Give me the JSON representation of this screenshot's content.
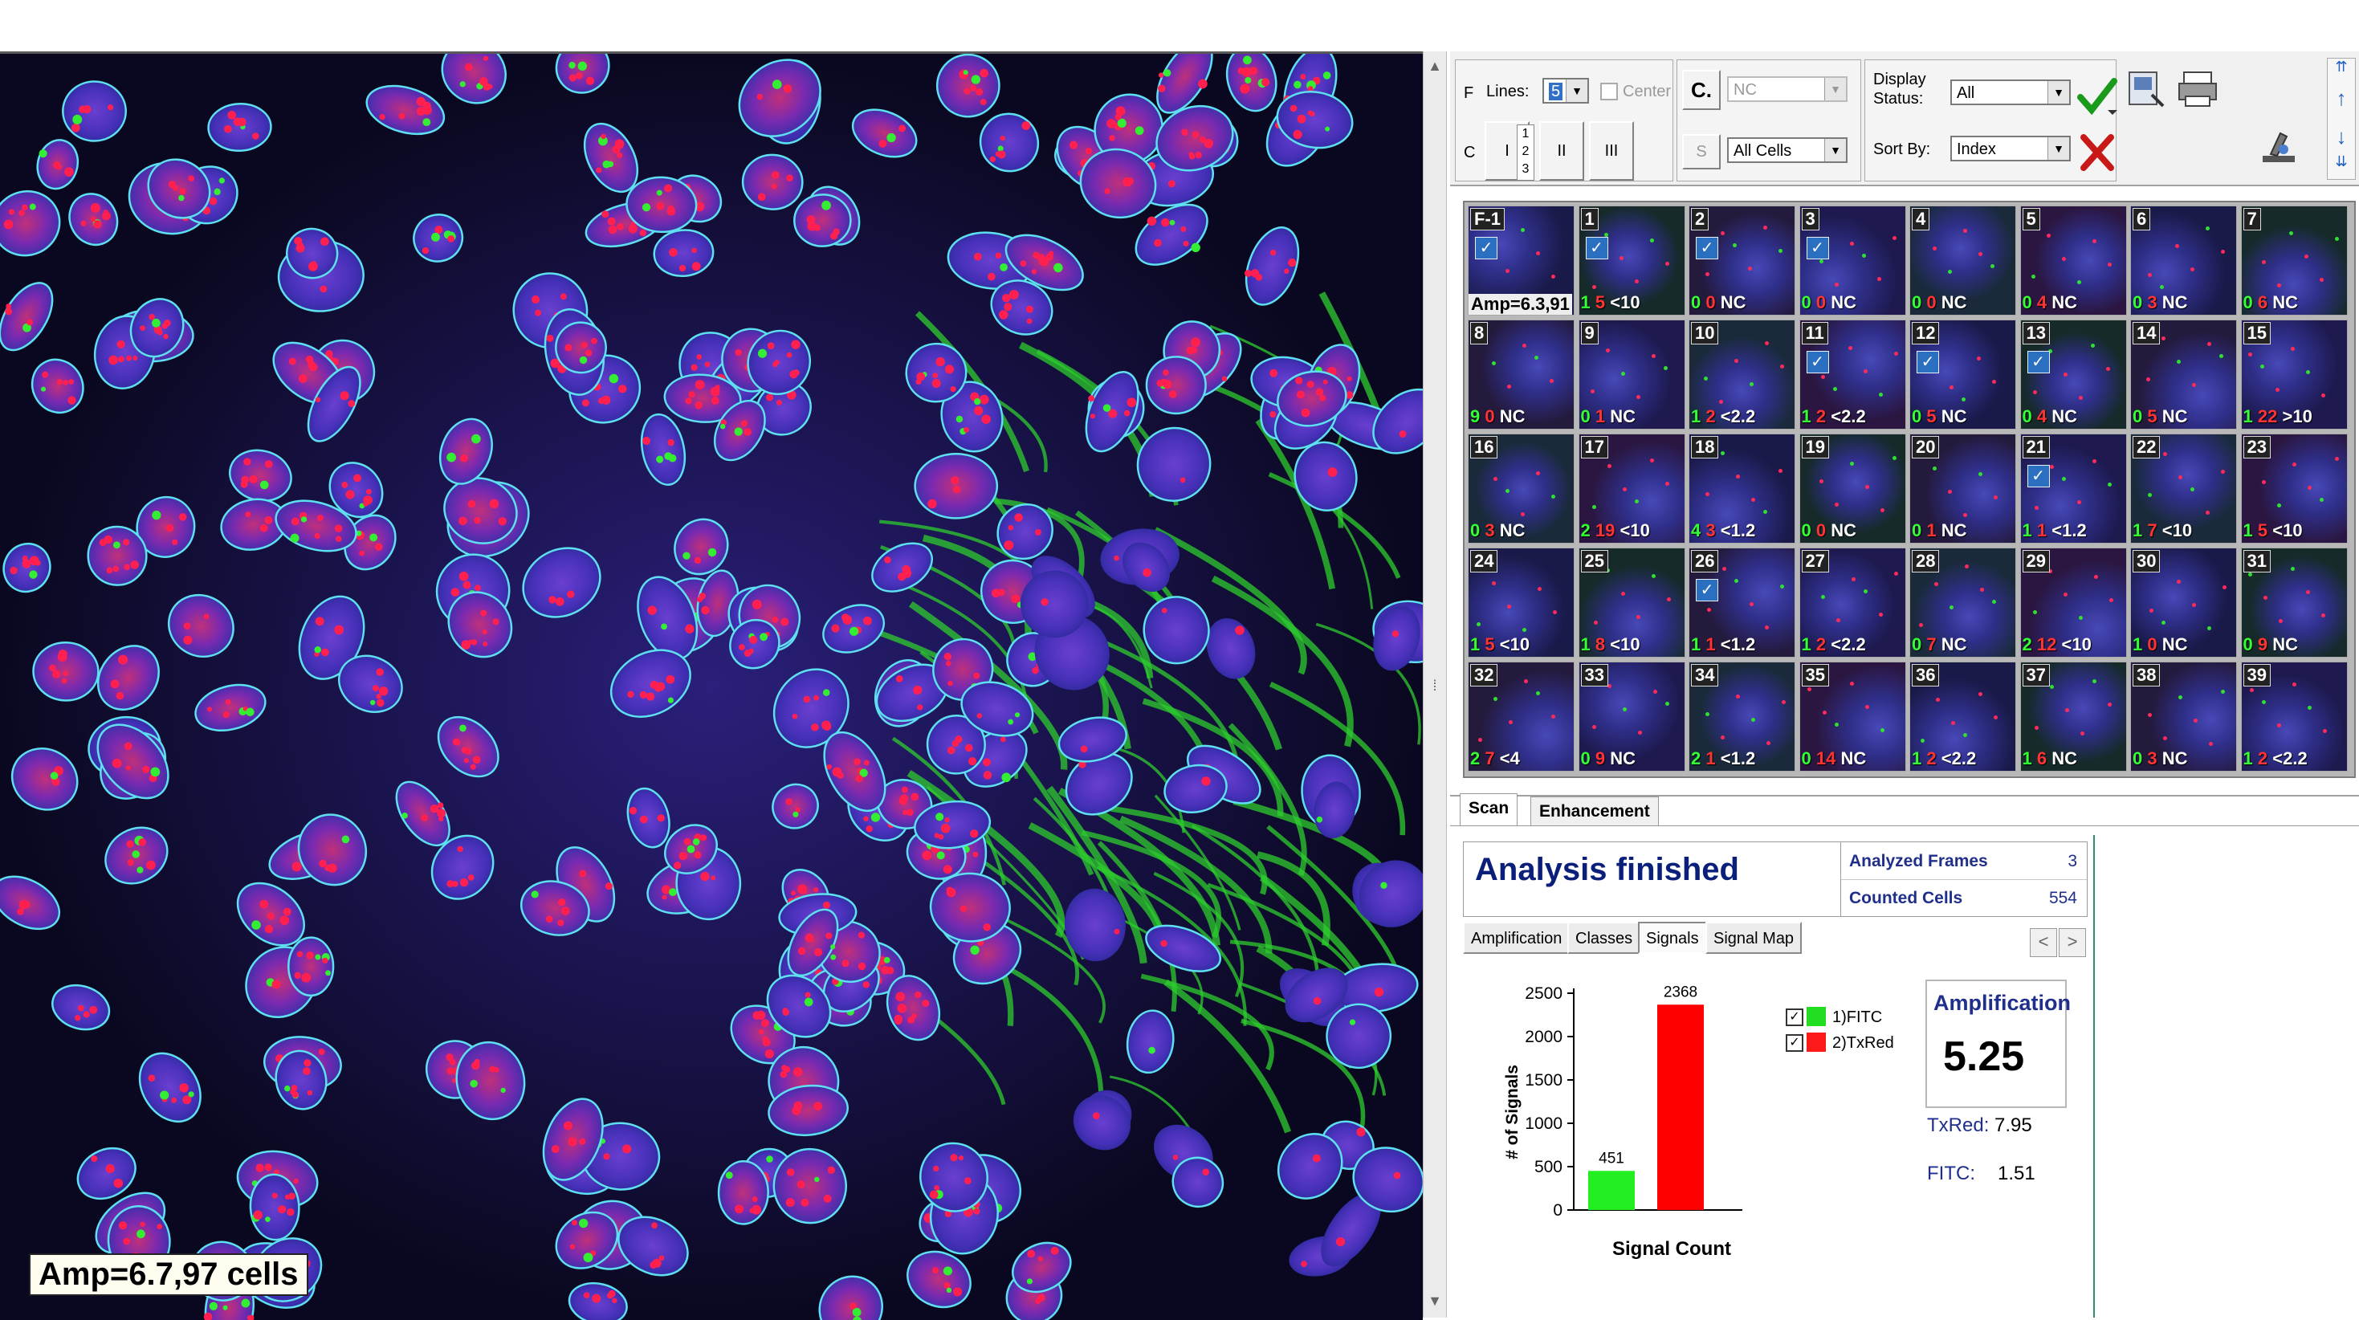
{
  "viewer": {
    "amp_label": "Amp=6.7,97 cells"
  },
  "toolbar": {
    "f_label": "F",
    "c_label": "C",
    "lines_label": "Lines:",
    "lines_value": "5",
    "center_label": "Center",
    "c_icon_label": "C.",
    "class_value": "NC",
    "s_label": "S",
    "cells_value": "All Cells",
    "display_status_label": "Display Status:",
    "display_status_value": "All",
    "sort_by_label": "Sort By:",
    "sort_by_value": "Index",
    "layout_buttons": [
      "I",
      "II",
      "III"
    ],
    "layout_stack": [
      "1",
      "2",
      "3"
    ]
  },
  "thumbnails": [
    {
      "id": "F-1",
      "checked": true,
      "amp": "Amp=6.3,91"
    },
    {
      "id": "1",
      "checked": true,
      "g": "1",
      "r": "5",
      "cls": "<10"
    },
    {
      "id": "2",
      "checked": true,
      "g": "0",
      "r": "0",
      "cls": "NC"
    },
    {
      "id": "3",
      "checked": true,
      "g": "0",
      "r": "0",
      "cls": "NC"
    },
    {
      "id": "4",
      "checked": false,
      "g": "0",
      "r": "0",
      "cls": "NC"
    },
    {
      "id": "5",
      "checked": false,
      "g": "0",
      "r": "4",
      "cls": "NC"
    },
    {
      "id": "6",
      "checked": false,
      "g": "0",
      "r": "3",
      "cls": "NC"
    },
    {
      "id": "7",
      "checked": false,
      "g": "0",
      "r": "6",
      "cls": "NC"
    },
    {
      "id": "8",
      "checked": false,
      "g": "9",
      "r": "0",
      "cls": "NC"
    },
    {
      "id": "9",
      "checked": false,
      "g": "0",
      "r": "1",
      "cls": "NC"
    },
    {
      "id": "10",
      "checked": false,
      "g": "1",
      "r": "2",
      "cls": "<2.2"
    },
    {
      "id": "11",
      "checked": true,
      "g": "1",
      "r": "2",
      "cls": "<2.2"
    },
    {
      "id": "12",
      "checked": true,
      "g": "0",
      "r": "5",
      "cls": "NC"
    },
    {
      "id": "13",
      "checked": true,
      "g": "0",
      "r": "4",
      "cls": "NC"
    },
    {
      "id": "14",
      "checked": false,
      "g": "0",
      "r": "5",
      "cls": "NC"
    },
    {
      "id": "15",
      "checked": false,
      "g": "1",
      "r": "22",
      "cls": ">10"
    },
    {
      "id": "16",
      "checked": false,
      "g": "0",
      "r": "3",
      "cls": "NC"
    },
    {
      "id": "17",
      "checked": false,
      "g": "2",
      "r": "19",
      "cls": "<10"
    },
    {
      "id": "18",
      "checked": false,
      "g": "4",
      "r": "3",
      "cls": "<1.2"
    },
    {
      "id": "19",
      "checked": false,
      "g": "0",
      "r": "0",
      "cls": "NC"
    },
    {
      "id": "20",
      "checked": false,
      "g": "0",
      "r": "1",
      "cls": "NC"
    },
    {
      "id": "21",
      "checked": true,
      "g": "1",
      "r": "1",
      "cls": "<1.2"
    },
    {
      "id": "22",
      "checked": false,
      "g": "1",
      "r": "7",
      "cls": "<10"
    },
    {
      "id": "23",
      "checked": false,
      "g": "1",
      "r": "5",
      "cls": "<10"
    },
    {
      "id": "24",
      "checked": false,
      "g": "1",
      "r": "5",
      "cls": "<10"
    },
    {
      "id": "25",
      "checked": false,
      "g": "1",
      "r": "8",
      "cls": "<10"
    },
    {
      "id": "26",
      "checked": true,
      "g": "1",
      "r": "1",
      "cls": "<1.2"
    },
    {
      "id": "27",
      "checked": false,
      "g": "1",
      "r": "2",
      "cls": "<2.2"
    },
    {
      "id": "28",
      "checked": false,
      "g": "0",
      "r": "7",
      "cls": "NC"
    },
    {
      "id": "29",
      "checked": false,
      "g": "2",
      "r": "12",
      "cls": "<10"
    },
    {
      "id": "30",
      "checked": false,
      "g": "1",
      "r": "0",
      "cls": "NC"
    },
    {
      "id": "31",
      "checked": false,
      "g": "0",
      "r": "9",
      "cls": "NC"
    },
    {
      "id": "32",
      "checked": false,
      "g": "2",
      "r": "7",
      "cls": "<4"
    },
    {
      "id": "33",
      "checked": false,
      "g": "0",
      "r": "9",
      "cls": "NC"
    },
    {
      "id": "34",
      "checked": false,
      "g": "2",
      "r": "1",
      "cls": "<1.2"
    },
    {
      "id": "35",
      "checked": false,
      "g": "0",
      "r": "14",
      "cls": "NC"
    },
    {
      "id": "36",
      "checked": false,
      "g": "1",
      "r": "2",
      "cls": "<2.2"
    },
    {
      "id": "37",
      "checked": false,
      "g": "1",
      "r": "6",
      "cls": "NC"
    },
    {
      "id": "38",
      "checked": false,
      "g": "0",
      "r": "3",
      "cls": "NC"
    },
    {
      "id": "39",
      "checked": false,
      "g": "1",
      "r": "2",
      "cls": "<2.2"
    }
  ],
  "panel": {
    "tabs": [
      "Scan",
      "Enhancement"
    ],
    "status": "Analysis finished",
    "stats": [
      {
        "label": "Analyzed Frames",
        "value": "3"
      },
      {
        "label": "Counted Cells",
        "value": "554"
      }
    ],
    "subtabs": [
      "Amplification",
      "Classes",
      "Signals",
      "Signal Map"
    ],
    "nav_prev": "<",
    "nav_next": ">",
    "legend": [
      {
        "label": "1)FITC",
        "color": "#22dd22",
        "checked": true
      },
      {
        "label": "2)TxRed",
        "color": "#ff1a1a",
        "checked": true
      }
    ],
    "amplification_title": "Amplification",
    "amplification_value": "5.25",
    "txred_label": "TxRed:",
    "txred_value": "7.95",
    "fitc_label": "FITC:",
    "fitc_value": "1.51"
  },
  "chart_data": {
    "type": "bar",
    "categories": [
      "1)FITC",
      "2)TxRed"
    ],
    "values": [
      451,
      2368
    ],
    "colors": [
      "#22ee22",
      "#ff0000"
    ],
    "xlabel": "Signal Count",
    "ylabel": "# of Signals",
    "ylim": [
      0,
      2500
    ],
    "yticks": [
      0,
      500,
      1000,
      1500,
      2000,
      2500
    ],
    "data_labels": [
      "451",
      "2368"
    ],
    "grid": false
  }
}
